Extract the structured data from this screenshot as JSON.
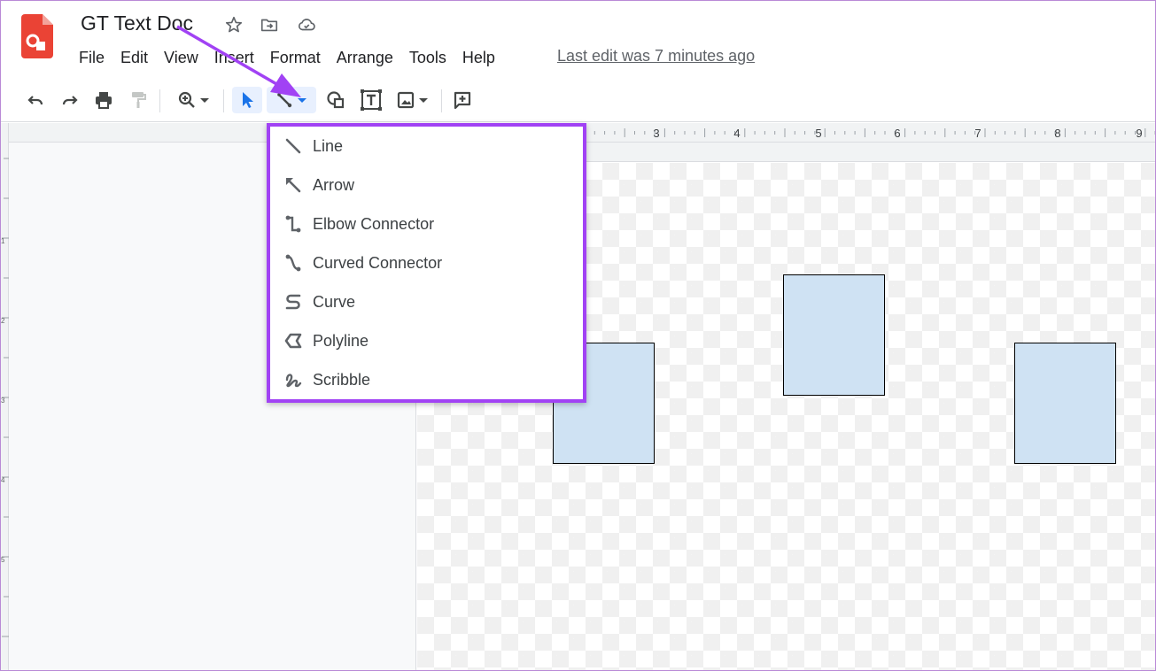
{
  "document": {
    "title": "GT Text Doc",
    "last_edit": "Last edit was 7 minutes ago"
  },
  "menu": [
    "File",
    "Edit",
    "View",
    "Insert",
    "Format",
    "Arrange",
    "Tools",
    "Help"
  ],
  "ruler": {
    "labels": [
      "3",
      "4",
      "5",
      "6",
      "7",
      "8",
      "9"
    ],
    "side_labels": [
      "1",
      "2",
      "3",
      "4",
      "5"
    ]
  },
  "line_menu": {
    "items": [
      {
        "label": "Line",
        "icon": "line-icon"
      },
      {
        "label": "Arrow",
        "icon": "arrow-icon"
      },
      {
        "label": "Elbow Connector",
        "icon": "elbow-connector-icon"
      },
      {
        "label": "Curved Connector",
        "icon": "curved-connector-icon"
      },
      {
        "label": "Curve",
        "icon": "curve-icon"
      },
      {
        "label": "Polyline",
        "icon": "polyline-icon"
      },
      {
        "label": "Scribble",
        "icon": "scribble-icon"
      }
    ]
  },
  "colors": {
    "accent": "#a142f4",
    "shape_fill": "#cfe2f3",
    "app_logo": "#ea4335",
    "select_blue": "#1a73e8"
  }
}
